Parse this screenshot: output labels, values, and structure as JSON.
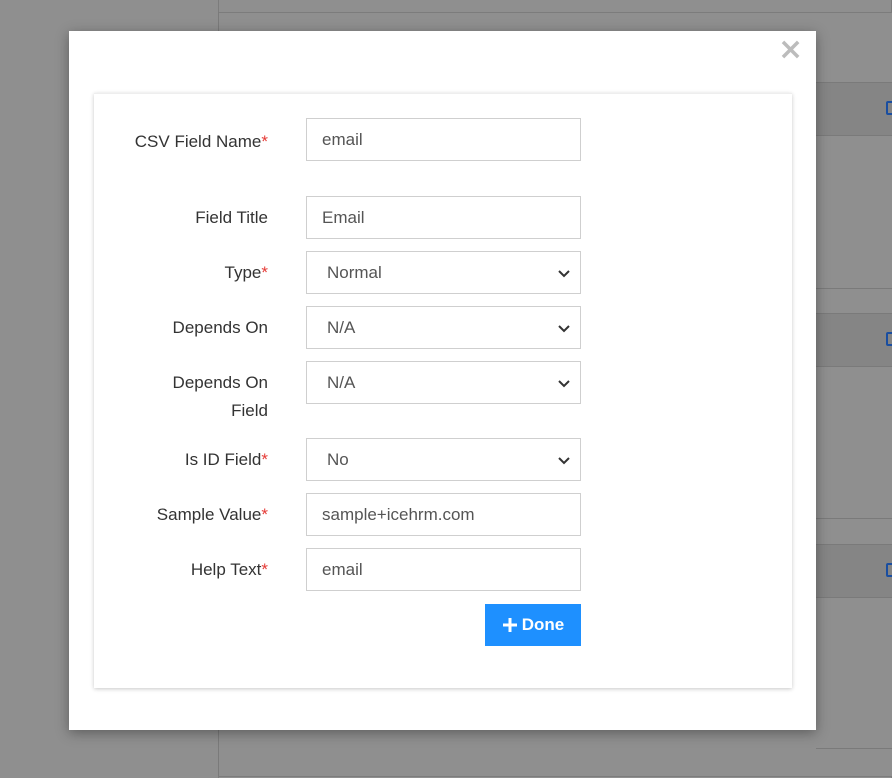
{
  "modal": {
    "close_symbol": "×",
    "close_icon": "close-icon"
  },
  "form": {
    "required_marker": "*",
    "fields": [
      {
        "label": "CSV Field Name",
        "required": true,
        "kind": "input",
        "value": "email"
      },
      {
        "label": "Field Title",
        "required": false,
        "kind": "input",
        "value": "Email"
      },
      {
        "label": "Type",
        "required": true,
        "kind": "select",
        "value": "Normal"
      },
      {
        "label": "Depends On",
        "required": false,
        "kind": "select",
        "value": "N/A"
      },
      {
        "label": "Depends On Field",
        "required": false,
        "kind": "select",
        "value": "N/A"
      },
      {
        "label": "Is ID Field",
        "required": true,
        "kind": "select",
        "value": "No"
      },
      {
        "label": "Sample Value",
        "required": true,
        "kind": "input",
        "value": "sample+icehrm.com"
      },
      {
        "label": "Help Text",
        "required": true,
        "kind": "input",
        "value": "email"
      }
    ],
    "done_button": {
      "label": "Done",
      "icon": "plus-icon"
    }
  },
  "colors": {
    "accent": "#1e90ff",
    "required": "#e53935",
    "overlay": "#8f8f8f"
  }
}
